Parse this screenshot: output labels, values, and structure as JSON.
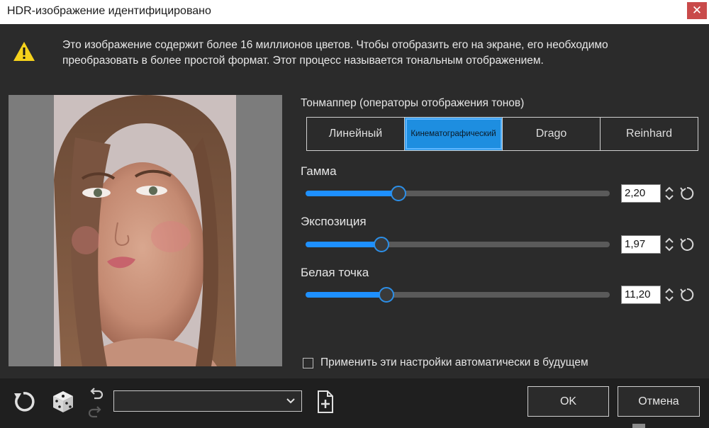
{
  "window": {
    "title": "HDR-изображение идентифицировано",
    "close_glyph": "✕"
  },
  "warning": {
    "icon": "warning-triangle-icon",
    "text": "Это изображение содержит более 16 миллионов цветов. Чтобы отобразить его на экране, его необходимо преобразовать в более простой формат. Этот процесс называется тональным отображением."
  },
  "tonemapper": {
    "label": "Тонмаппер (операторы отображения тонов)",
    "options": [
      "Линейный",
      "Кинематографический",
      "Drago",
      "Reinhard"
    ],
    "selected": "Кинематографический"
  },
  "params": [
    {
      "label": "Гамма",
      "value": "2,20",
      "fraction": 0.305
    },
    {
      "label": "Экспозиция",
      "value": "1,97",
      "fraction": 0.25
    },
    {
      "label": "Белая точка",
      "value": "11,20",
      "fraction": 0.265
    }
  ],
  "auto_apply": {
    "label": "Применить эти настройки автоматически в будущем",
    "checked": false
  },
  "footer": {
    "preset_value": "",
    "ok_label": "OK",
    "cancel_label": "Отмена"
  },
  "colors": {
    "accent": "#1e90ff",
    "background": "#2b2b2b",
    "footer": "#1f1f1f",
    "warning": "#f5d21c"
  }
}
